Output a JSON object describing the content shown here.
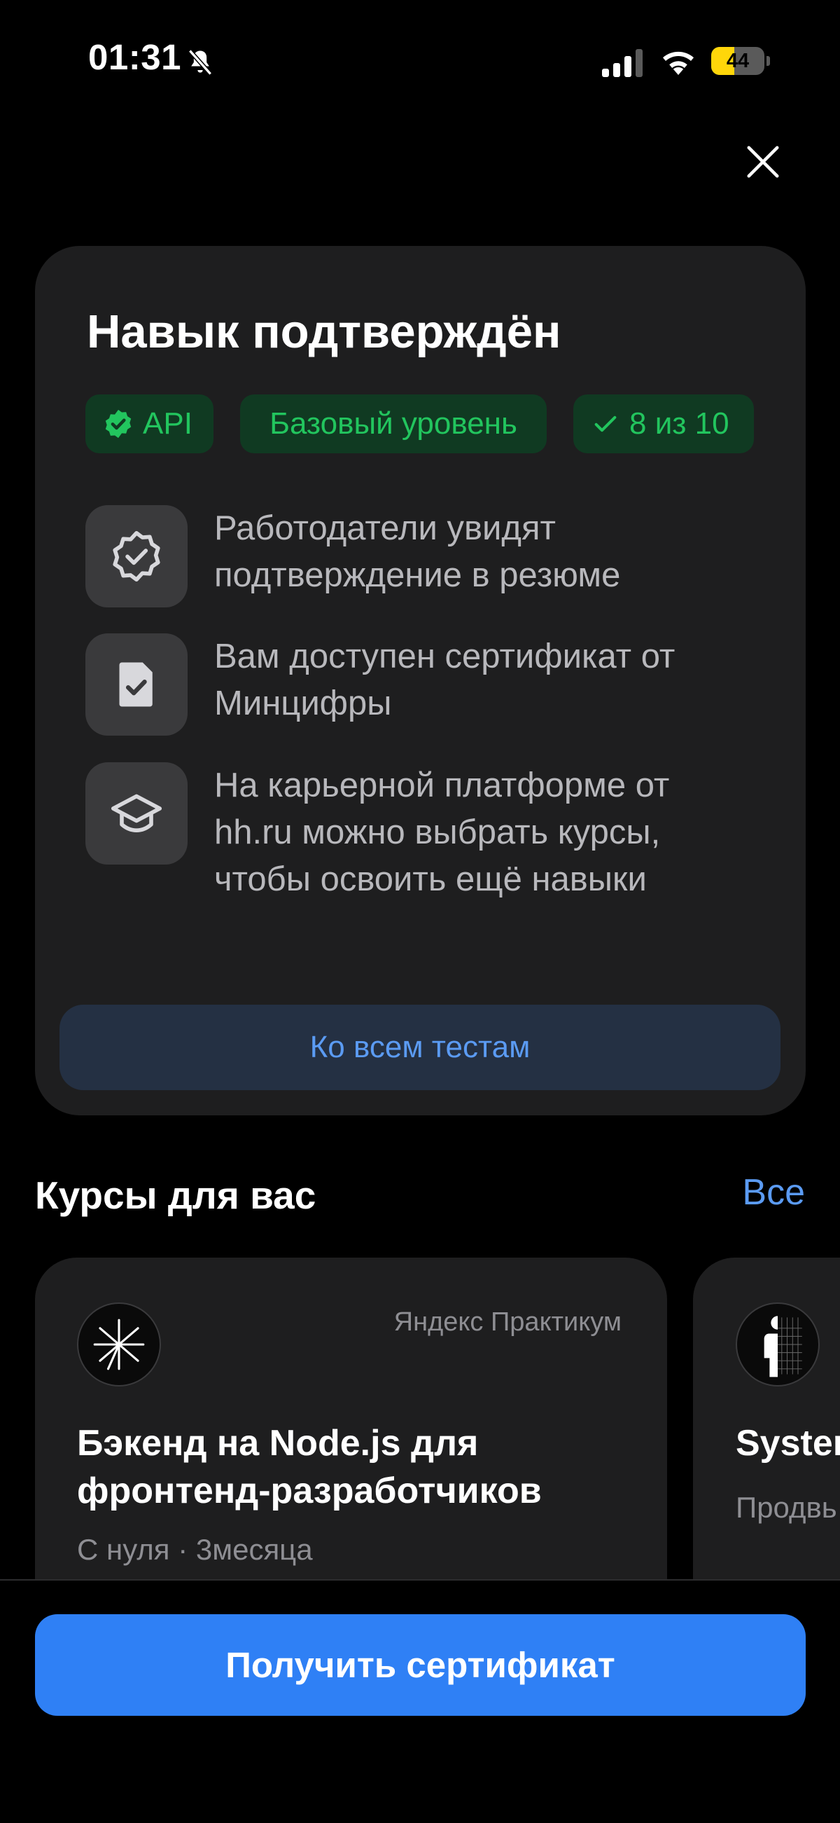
{
  "status_bar": {
    "time": "01:31",
    "battery_level": "44",
    "battery_fraction": 0.44,
    "icons": [
      "bell-muted-icon",
      "cellular-signal-icon",
      "wifi-icon",
      "battery-icon"
    ],
    "battery_color": "#ffd60a"
  },
  "modal": {
    "close_icon": "close-icon",
    "title": "Навык подтверждён",
    "chips": {
      "skill": "API",
      "level": "Базовый уровень",
      "score": "8 из 10"
    },
    "features": [
      {
        "icon": "verified-badge-icon",
        "text": "Работодатели увидят подтверждение в резюме"
      },
      {
        "icon": "certificate-document-icon",
        "text": "Вам доступен сертификат от Минцифры"
      },
      {
        "icon": "graduation-cap-icon",
        "text": "На карьерной платформе от hh.ru можно выбрать курсы, чтобы освоить ещё навыки"
      }
    ],
    "all_tests_label": "Ко всем тестам"
  },
  "courses": {
    "title": "Курсы для вас",
    "see_all_label": "Все",
    "items": [
      {
        "provider": "Яндекс Практикум",
        "logo": "yandex-practicum-logo",
        "title": "Бэкенд на Node.js для фронтенд-разработчиков",
        "meta": "С нуля · 3месяца"
      },
      {
        "logo": "person-wireframe-logo",
        "title": "Syster",
        "meta": "Продвь"
      }
    ]
  },
  "bottom": {
    "get_certificate_label": "Получить сертификат"
  },
  "colors": {
    "accent_blue": "#2f80f5",
    "link_blue": "#5b9bf3",
    "success_green": "#22c55e",
    "chip_background": "#103a22",
    "card_background": "#1e1e1f"
  }
}
